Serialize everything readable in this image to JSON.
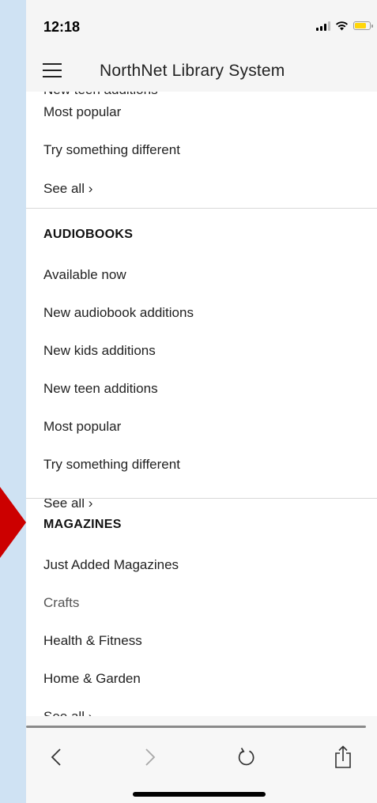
{
  "status_bar": {
    "time": "12:18"
  },
  "nav": {
    "title": "NorthNet Library System"
  },
  "menu": {
    "clipped_item": "New teen additions",
    "top_section_items": [
      "Most popular",
      "Try something different"
    ],
    "top_see_all": "See all ›",
    "audiobooks": {
      "heading": "AUDIOBOOKS",
      "items": [
        "Available now",
        "New audiobook additions",
        "New kids additions",
        "New teen additions",
        "Most popular",
        "Try something different"
      ],
      "see_all": "See all ›"
    },
    "magazines": {
      "heading": "MAGAZINES",
      "items": [
        "Just Added Magazines",
        "Crafts",
        "Health & Fitness",
        "Home & Garden"
      ],
      "see_all": "See all ›"
    }
  },
  "colors": {
    "accent_arrow": "#cc0000",
    "background_frame": "#cfe2f3",
    "battery_fill": "#ffd60a"
  },
  "icons": {
    "menu": "hamburger-icon",
    "back": "chevron-left-icon",
    "forward": "chevron-right-icon",
    "reload": "reload-icon",
    "share": "share-icon",
    "wifi": "wifi-icon",
    "signal": "signal-icon",
    "battery": "battery-icon"
  }
}
